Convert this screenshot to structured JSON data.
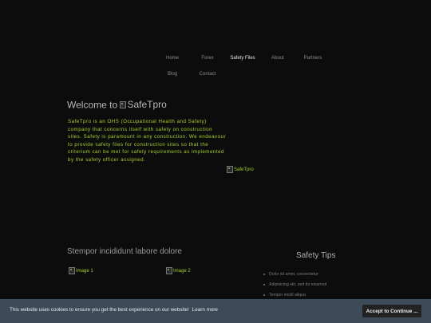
{
  "nav": {
    "row1": [
      "Home",
      "Forex",
      "Safety Files",
      "About",
      "Partners"
    ],
    "row2": [
      "Blog",
      "Contact"
    ],
    "active": "Safety Files"
  },
  "welcome": {
    "prefix": "Welcome to",
    "brand_alt": "SafeTpro"
  },
  "intro_text": "SafeTpro is an OHS (Occupational Health and Safety) company that concerns itself with safety on construction sites. Safety is paramount in any construction. We endeavour to provide safety files for construction sites so that the criterium can be met for safety requirements as implemented by the safety officer assigned.",
  "logo_alt": "SafeTpro",
  "section": {
    "title": "Stempor incididunt labore dolore",
    "image1_alt": "Image 1",
    "image2_alt": "Image 2"
  },
  "tips": {
    "title": "Safety Tips",
    "items": [
      "Dolor sit amet, consectetur",
      "Adipisicing elit, sed do eiusmod",
      "Tempor incidi aliqua"
    ]
  },
  "cookie": {
    "message": "This website uses cookies to ensure you get the best experience on our website!",
    "learn_more": "Learn more",
    "accept": "Accept to Continue ..."
  },
  "colors": {
    "background": "#0c0c0c",
    "accent_green": "#a7d130",
    "cookie_bar": "#3d4a57",
    "accept_button": "#222222"
  },
  "icons": {
    "broken_image": "broken-image-icon",
    "bullet": "bullet-icon"
  }
}
